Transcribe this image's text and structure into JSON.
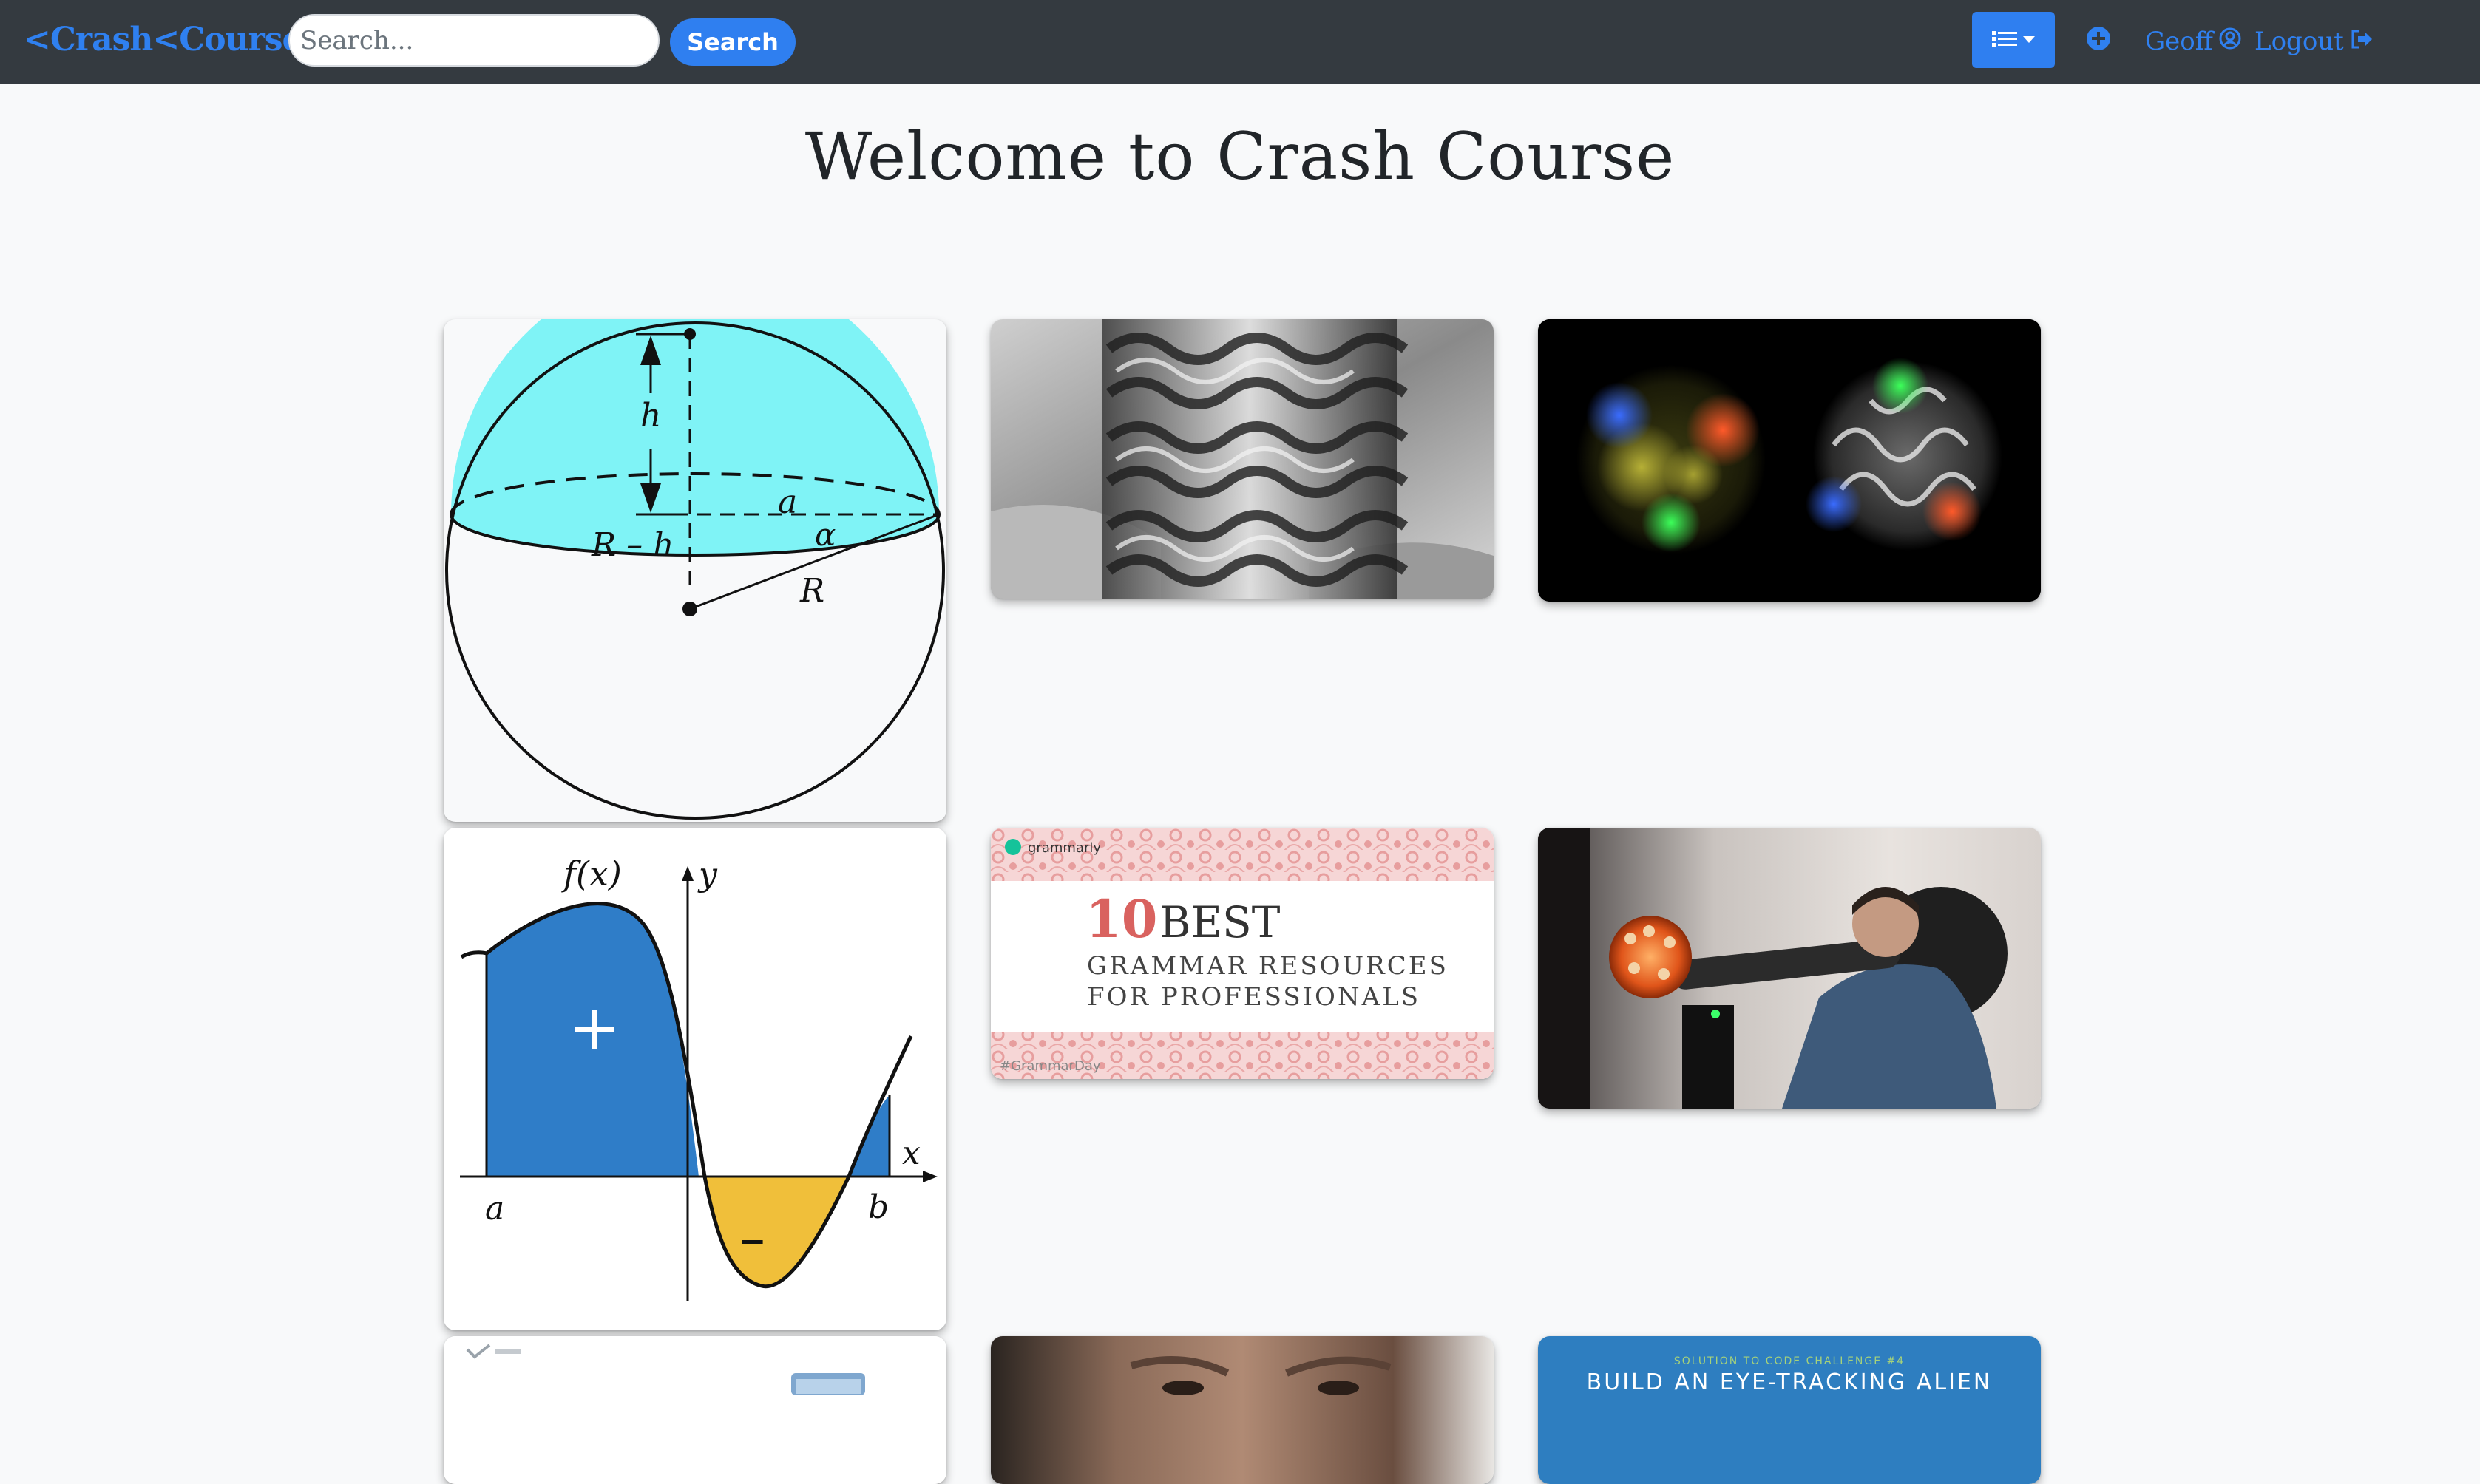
{
  "navbar": {
    "brand": "<Crash<Course",
    "search_placeholder": "Search...",
    "search_label": "Search",
    "menu_icon": "list-icon",
    "add_icon": "plus-circle-icon",
    "username": "Geoff",
    "user_icon": "user-circle-icon",
    "logout_label": "Logout",
    "logout_icon": "sign-out-icon",
    "accent_color": "#2f7ff0",
    "bar_color": "#343a40"
  },
  "page": {
    "title": "Welcome to Crash Course"
  },
  "cards": [
    {
      "image": "sphere-cap-diagram",
      "labels": {
        "h": "h",
        "a": "a",
        "rh": "R – h",
        "alpha": "α",
        "r": "R"
      }
    },
    {
      "image": "gyroid-3d-print-photo"
    },
    {
      "image": "glowing-sphere-render"
    },
    {
      "image": "integral-area-graph",
      "labels": {
        "fx": "f(x)",
        "y": "y",
        "x": "x",
        "a": "a",
        "b": "b",
        "plus": "+",
        "minus": "–"
      }
    },
    {
      "image": "grammarly-banner",
      "labels": {
        "brand": "grammarly",
        "number": "10",
        "best": "BEST",
        "line1": "GRAMMAR RESOURCES",
        "line2": "FOR PROFESSIONALS",
        "tag": "#GrammarDay"
      }
    },
    {
      "image": "man-with-prop-blaster-photo"
    },
    {
      "image": "document-with-flask"
    },
    {
      "image": "elderly-man-portrait"
    },
    {
      "image": "code-challenge-thumbnail",
      "labels": {
        "kicker": "SOLUTION TO CODE CHALLENGE #4",
        "title": "BUILD AN EYE-TRACKING ALIEN"
      }
    }
  ]
}
